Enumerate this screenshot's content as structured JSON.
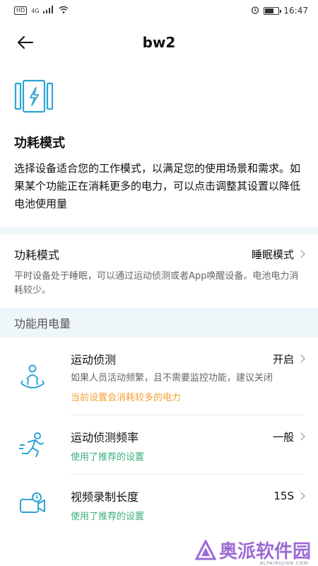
{
  "status_bar": {
    "left": "HD",
    "network": "4G",
    "time": "16:47"
  },
  "header": {
    "title": "bw2"
  },
  "intro": {
    "title": "功耗模式",
    "description": "选择设备适合您的工作模式，以满足您的使用场景和需求。如果某个功能正在消耗更多的电力，可以点击调整其设置以降低电池使用量"
  },
  "power_mode": {
    "label": "功耗模式",
    "value": "睡眠模式",
    "description": "平时设备处于睡眠，可以通过运动侦测或者App唤醒设备。电池电力消耗较少。"
  },
  "section": {
    "title": "功能用电量"
  },
  "features": [
    {
      "name": "运动侦测",
      "value": "开启",
      "description": "如果人员活动频繁，且不需要监控功能，建议关闭",
      "note": "当前设置会消耗较多的电力"
    },
    {
      "name": "运动侦测频率",
      "value": "一般",
      "note": "使用了推荐的设置"
    },
    {
      "name": "视频录制长度",
      "value": "15S",
      "note": "使用了推荐的设置"
    }
  ],
  "watermark": {
    "text": "奥派软件园",
    "sub": "ALPAIRUJIAN.COM"
  },
  "colors": {
    "accent": "#2fa3d6",
    "warning": "#f2a033",
    "ok": "#3ab07a",
    "section_bg": "#eef6fa"
  }
}
